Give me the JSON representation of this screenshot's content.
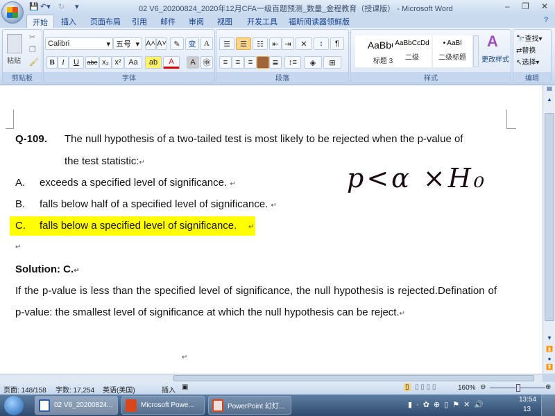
{
  "titlebar": {
    "title": "02 V6_20200824_2020年12月CFA一级百题预测_数量_金程教育（授课版） - Microsoft Word",
    "minimize": "–",
    "restore": "❐",
    "close": "✕"
  },
  "tabs": [
    "开始",
    "插入",
    "页面布局",
    "引用",
    "邮件",
    "审阅",
    "视图",
    "开发工具",
    "福昕阅读器领鲜版"
  ],
  "ribbon": {
    "clipboard": {
      "label": "剪贴板",
      "paste": "粘贴"
    },
    "font": {
      "label": "字体",
      "font_name": "Calibri",
      "font_size": "五号",
      "bold": "B",
      "italic": "I",
      "underline": "U",
      "strike": "abe",
      "sub": "x₂",
      "sup": "x²",
      "case": "Aa",
      "grow": "A˄",
      "shrink": "A˅",
      "phonetic": "变",
      "border_char": "A"
    },
    "paragraph": {
      "label": "段落"
    },
    "styles": {
      "label": "样式",
      "items": [
        {
          "preview": "AaBbC",
          "name": "标题 3"
        },
        {
          "preview": "AaBbCcDd",
          "name": "二级"
        },
        {
          "preview": "• AaBl",
          "name": "二级标题"
        }
      ],
      "change": "更改样式"
    },
    "editing": {
      "label": "编辑",
      "find": "查找",
      "replace": "替换",
      "select": "选择"
    }
  },
  "document": {
    "question_number": "Q-109.",
    "question_line1": "The null hypothesis of a two-tailed test is most likely to be rejected when the p-value of",
    "question_line2": "the test statistic:",
    "options": [
      {
        "letter": "A.",
        "text": "exceeds a specified level of significance."
      },
      {
        "letter": "B.",
        "text": "falls below half of a specified level of significance."
      },
      {
        "letter": "C.",
        "text": "falls below a specified level of significance."
      }
    ],
    "highlight_color": "#ffff00",
    "solution_label": "Solution: C.",
    "explanation": "If the p-value is less than the specified level of significance, the null hypothesis is rejected.Defination of p-value: the smallest level of significance at which the null hypothesis can be reject.",
    "para_mark": "↵",
    "handwriting": "p<α ×H₀"
  },
  "statusbar": {
    "page": "页面: 148/158",
    "words": "字数: 17,254",
    "language": "英语(美国)",
    "mode": "插入",
    "zoom": "160%"
  },
  "taskbar": {
    "items": [
      "02 V6_20200824...",
      "Microsoft Powe...",
      "PowerPoint 幻灯..."
    ],
    "time": "13:54",
    "date": "13"
  }
}
